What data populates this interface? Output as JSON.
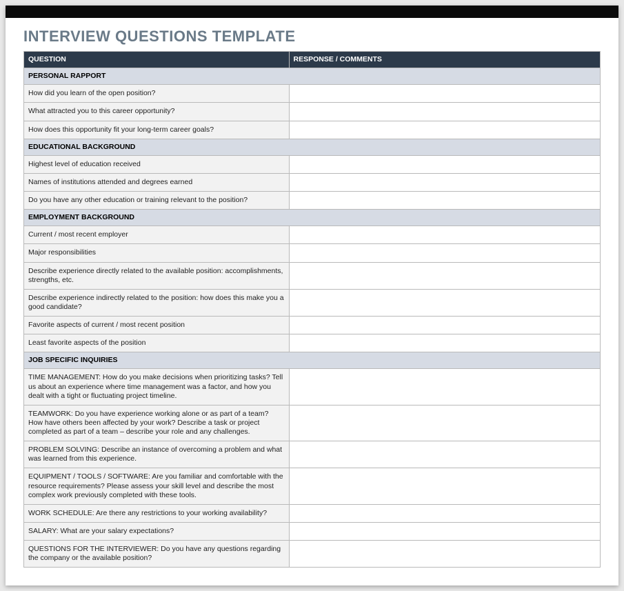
{
  "title": "INTERVIEW QUESTIONS TEMPLATE",
  "headers": {
    "question": "QUESTION",
    "response": "RESPONSE / COMMENTS"
  },
  "sections": [
    {
      "name": "PERSONAL RAPPORT",
      "rows": [
        {
          "q": "How did you learn of the open position?",
          "r": ""
        },
        {
          "q": "What attracted you to this career opportunity?",
          "r": ""
        },
        {
          "q": "How does this opportunity fit your long-term career goals?",
          "r": ""
        }
      ]
    },
    {
      "name": "EDUCATIONAL BACKGROUND",
      "rows": [
        {
          "q": "Highest level of education received",
          "r": ""
        },
        {
          "q": "Names of institutions attended and degrees earned",
          "r": ""
        },
        {
          "q": "Do you have any other education or training relevant to the position?",
          "r": ""
        }
      ]
    },
    {
      "name": "EMPLOYMENT BACKGROUND",
      "rows": [
        {
          "q": "Current / most recent employer",
          "r": ""
        },
        {
          "q": "Major responsibilities",
          "r": ""
        },
        {
          "q": "Describe experience directly related to the available position: accomplishments, strengths, etc.",
          "r": ""
        },
        {
          "q": "Describe experience indirectly related to the position: how does this make you a good candidate?",
          "r": ""
        },
        {
          "q": "Favorite aspects of current / most recent position",
          "r": ""
        },
        {
          "q": "Least favorite aspects of the position",
          "r": ""
        }
      ]
    },
    {
      "name": "JOB SPECIFIC INQUIRIES",
      "rows": [
        {
          "q": "TIME MANAGEMENT: How do you make decisions when prioritizing tasks? Tell us about an experience where time management was a factor, and how you dealt with a tight or fluctuating project timeline.",
          "r": ""
        },
        {
          "q": "TEAMWORK: Do you have experience working alone or as part of a team? How have others been affected by your work? Describe a task or project completed as part of a team – describe your role and any challenges.",
          "r": ""
        },
        {
          "q": "PROBLEM SOLVING: Describe an instance of overcoming a problem and what was learned from this experience.",
          "r": ""
        },
        {
          "q": "EQUIPMENT / TOOLS / SOFTWARE: Are you familiar and comfortable with the resource requirements? Please assess your skill level and describe the most complex work previously completed with these tools.",
          "r": ""
        },
        {
          "q": "WORK SCHEDULE: Are there any restrictions to your working availability?",
          "r": ""
        },
        {
          "q": "SALARY: What are your salary expectations?",
          "r": ""
        },
        {
          "q": "QUESTIONS FOR THE INTERVIEWER: Do you have any questions regarding the company or the available position?",
          "r": ""
        }
      ]
    }
  ]
}
